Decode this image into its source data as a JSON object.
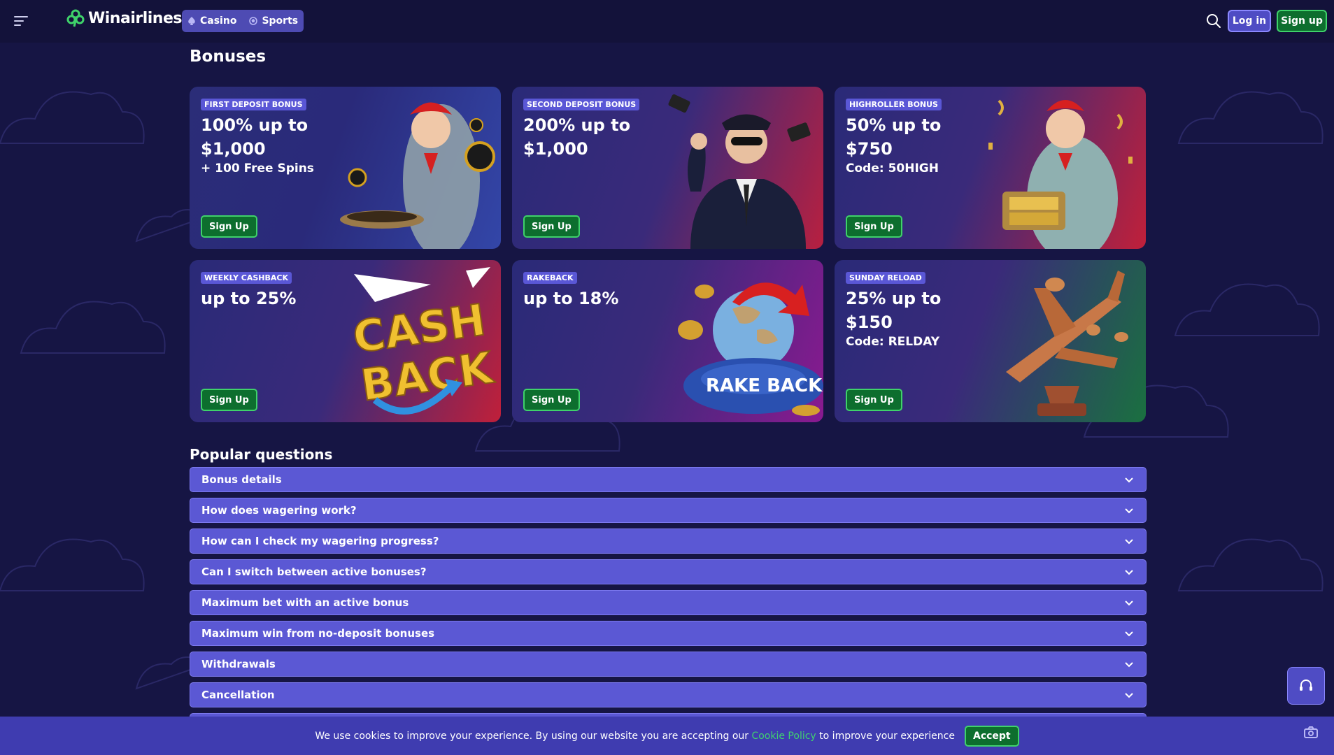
{
  "header": {
    "logo_text": "Winairlines",
    "tabs": [
      {
        "label": "Casino",
        "icon": "spade-icon"
      },
      {
        "label": "Sports",
        "icon": "ball-icon"
      }
    ],
    "login_label": "Log in",
    "signup_label": "Sign up"
  },
  "bonuses": {
    "title": "Bonuses",
    "cards": [
      {
        "tag": "FIRST DEPOSIT BONUS",
        "headline": "100% up to $1,000",
        "sub": "+ 100 Free Spins",
        "button": "Sign Up",
        "art": "stewardess-chips"
      },
      {
        "tag": "SECOND DEPOSIT BONUS",
        "headline": "200% up to $1,000",
        "sub": "",
        "button": "Sign Up",
        "art": "pilot"
      },
      {
        "tag": "HIGHROLLER BONUS",
        "headline": "50% up to $750",
        "sub": "Code: 50HIGH",
        "button": "Sign Up",
        "art": "stewardess-gold"
      },
      {
        "tag": "WEEKLY CASHBACK",
        "headline": "up to 25%",
        "sub": "",
        "button": "Sign Up",
        "art": "cash-back"
      },
      {
        "tag": "RAKEBACK",
        "headline": "up to 18%",
        "sub": "",
        "button": "Sign Up",
        "art": "rake-back-globe"
      },
      {
        "tag": "SUNDAY RELOAD",
        "headline": "25% up to $150",
        "sub": "Code: RELDAY",
        "button": "Sign Up",
        "art": "plane-trophy"
      }
    ]
  },
  "faq": {
    "title": "Popular questions",
    "items": [
      "Bonus details",
      "How does wagering work?",
      "How can I check my wagering progress?",
      "Can I switch between active bonuses?",
      "Maximum bet with an active bonus",
      "Maximum win from no-deposit bonuses",
      "Withdrawals",
      "Cancellation"
    ]
  },
  "cookie": {
    "text_before": "We use cookies to improve your experience. By using our website you are accepting our",
    "link": "Cookie Policy",
    "text_after": "to improve your experience",
    "accept": "Accept"
  },
  "art_text": {
    "cash_line1": "CASH",
    "cash_line2": "BACK",
    "rake_back": "RAKE BACK"
  },
  "colors": {
    "background": "#161544",
    "header": "#13123a",
    "accent": "#5b58d4",
    "signup_green": "#0d6e2e",
    "signup_border": "#3fd26a"
  }
}
